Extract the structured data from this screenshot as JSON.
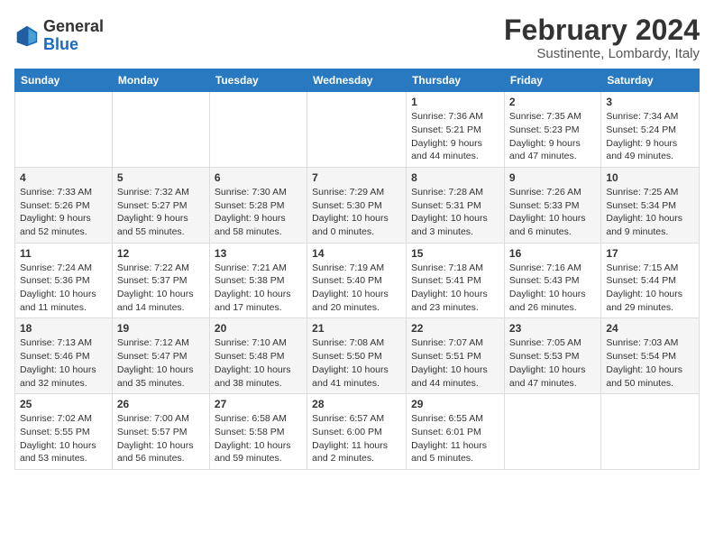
{
  "header": {
    "logo_line1": "General",
    "logo_line2": "Blue",
    "title": "February 2024",
    "subtitle": "Sustinente, Lombardy, Italy"
  },
  "columns": [
    "Sunday",
    "Monday",
    "Tuesday",
    "Wednesday",
    "Thursday",
    "Friday",
    "Saturday"
  ],
  "weeks": [
    [
      {
        "day": "",
        "info": ""
      },
      {
        "day": "",
        "info": ""
      },
      {
        "day": "",
        "info": ""
      },
      {
        "day": "",
        "info": ""
      },
      {
        "day": "1",
        "info": "Sunrise: 7:36 AM\nSunset: 5:21 PM\nDaylight: 9 hours and 44 minutes."
      },
      {
        "day": "2",
        "info": "Sunrise: 7:35 AM\nSunset: 5:23 PM\nDaylight: 9 hours and 47 minutes."
      },
      {
        "day": "3",
        "info": "Sunrise: 7:34 AM\nSunset: 5:24 PM\nDaylight: 9 hours and 49 minutes."
      }
    ],
    [
      {
        "day": "4",
        "info": "Sunrise: 7:33 AM\nSunset: 5:26 PM\nDaylight: 9 hours and 52 minutes."
      },
      {
        "day": "5",
        "info": "Sunrise: 7:32 AM\nSunset: 5:27 PM\nDaylight: 9 hours and 55 minutes."
      },
      {
        "day": "6",
        "info": "Sunrise: 7:30 AM\nSunset: 5:28 PM\nDaylight: 9 hours and 58 minutes."
      },
      {
        "day": "7",
        "info": "Sunrise: 7:29 AM\nSunset: 5:30 PM\nDaylight: 10 hours and 0 minutes."
      },
      {
        "day": "8",
        "info": "Sunrise: 7:28 AM\nSunset: 5:31 PM\nDaylight: 10 hours and 3 minutes."
      },
      {
        "day": "9",
        "info": "Sunrise: 7:26 AM\nSunset: 5:33 PM\nDaylight: 10 hours and 6 minutes."
      },
      {
        "day": "10",
        "info": "Sunrise: 7:25 AM\nSunset: 5:34 PM\nDaylight: 10 hours and 9 minutes."
      }
    ],
    [
      {
        "day": "11",
        "info": "Sunrise: 7:24 AM\nSunset: 5:36 PM\nDaylight: 10 hours and 11 minutes."
      },
      {
        "day": "12",
        "info": "Sunrise: 7:22 AM\nSunset: 5:37 PM\nDaylight: 10 hours and 14 minutes."
      },
      {
        "day": "13",
        "info": "Sunrise: 7:21 AM\nSunset: 5:38 PM\nDaylight: 10 hours and 17 minutes."
      },
      {
        "day": "14",
        "info": "Sunrise: 7:19 AM\nSunset: 5:40 PM\nDaylight: 10 hours and 20 minutes."
      },
      {
        "day": "15",
        "info": "Sunrise: 7:18 AM\nSunset: 5:41 PM\nDaylight: 10 hours and 23 minutes."
      },
      {
        "day": "16",
        "info": "Sunrise: 7:16 AM\nSunset: 5:43 PM\nDaylight: 10 hours and 26 minutes."
      },
      {
        "day": "17",
        "info": "Sunrise: 7:15 AM\nSunset: 5:44 PM\nDaylight: 10 hours and 29 minutes."
      }
    ],
    [
      {
        "day": "18",
        "info": "Sunrise: 7:13 AM\nSunset: 5:46 PM\nDaylight: 10 hours and 32 minutes."
      },
      {
        "day": "19",
        "info": "Sunrise: 7:12 AM\nSunset: 5:47 PM\nDaylight: 10 hours and 35 minutes."
      },
      {
        "day": "20",
        "info": "Sunrise: 7:10 AM\nSunset: 5:48 PM\nDaylight: 10 hours and 38 minutes."
      },
      {
        "day": "21",
        "info": "Sunrise: 7:08 AM\nSunset: 5:50 PM\nDaylight: 10 hours and 41 minutes."
      },
      {
        "day": "22",
        "info": "Sunrise: 7:07 AM\nSunset: 5:51 PM\nDaylight: 10 hours and 44 minutes."
      },
      {
        "day": "23",
        "info": "Sunrise: 7:05 AM\nSunset: 5:53 PM\nDaylight: 10 hours and 47 minutes."
      },
      {
        "day": "24",
        "info": "Sunrise: 7:03 AM\nSunset: 5:54 PM\nDaylight: 10 hours and 50 minutes."
      }
    ],
    [
      {
        "day": "25",
        "info": "Sunrise: 7:02 AM\nSunset: 5:55 PM\nDaylight: 10 hours and 53 minutes."
      },
      {
        "day": "26",
        "info": "Sunrise: 7:00 AM\nSunset: 5:57 PM\nDaylight: 10 hours and 56 minutes."
      },
      {
        "day": "27",
        "info": "Sunrise: 6:58 AM\nSunset: 5:58 PM\nDaylight: 10 hours and 59 minutes."
      },
      {
        "day": "28",
        "info": "Sunrise: 6:57 AM\nSunset: 6:00 PM\nDaylight: 11 hours and 2 minutes."
      },
      {
        "day": "29",
        "info": "Sunrise: 6:55 AM\nSunset: 6:01 PM\nDaylight: 11 hours and 5 minutes."
      },
      {
        "day": "",
        "info": ""
      },
      {
        "day": "",
        "info": ""
      }
    ]
  ]
}
